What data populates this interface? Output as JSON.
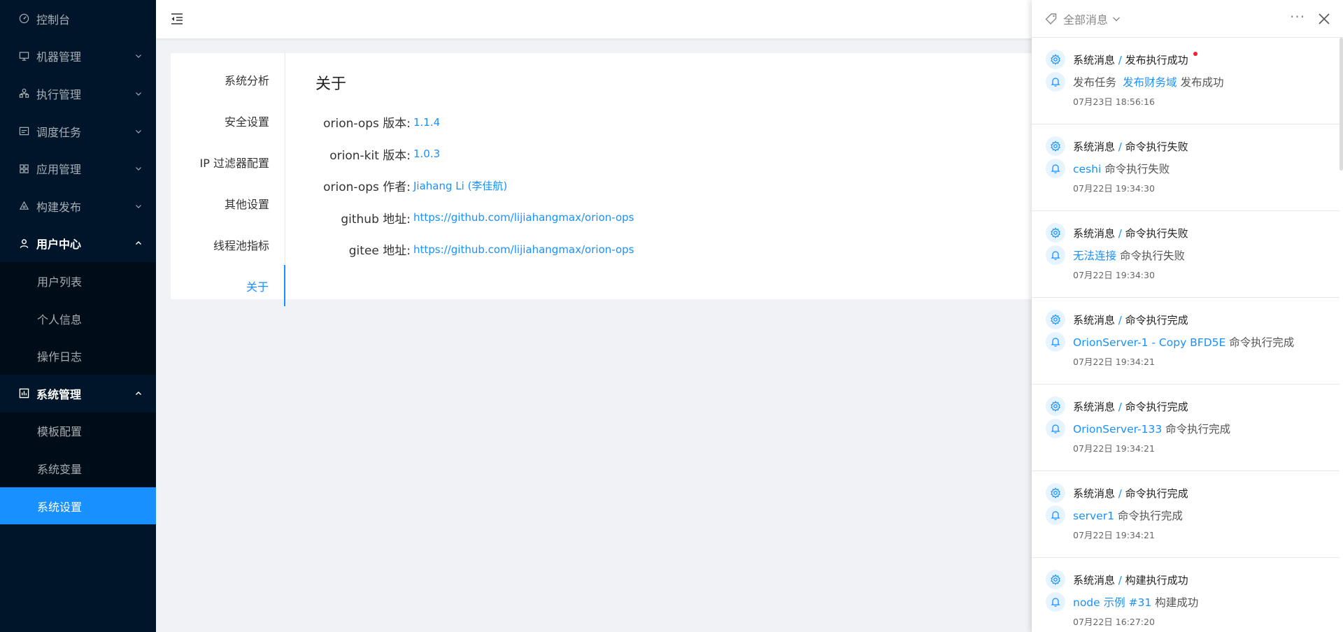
{
  "sidebar": {
    "items": [
      {
        "label": "控制台",
        "icon": "dashboard-icon"
      },
      {
        "label": "机器管理",
        "icon": "monitor-icon"
      },
      {
        "label": "执行管理",
        "icon": "cluster-icon"
      },
      {
        "label": "调度任务",
        "icon": "calendar-icon"
      },
      {
        "label": "应用管理",
        "icon": "grid-icon"
      },
      {
        "label": "构建发布",
        "icon": "build-icon"
      },
      {
        "label": "用户中心",
        "icon": "user-icon"
      },
      {
        "label": "系统管理",
        "icon": "chart-box-icon"
      }
    ],
    "user_center_sub": [
      "用户列表",
      "个人信息",
      "操作日志"
    ],
    "system_sub": [
      "模板配置",
      "系统变量",
      "系统设置"
    ]
  },
  "tabs": [
    "系统分析",
    "安全设置",
    "IP 过滤器配置",
    "其他设置",
    "线程池指标",
    "关于"
  ],
  "about": {
    "title": "关于",
    "rows": [
      {
        "k": "orion-ops 版本:",
        "v": "1.1.4"
      },
      {
        "k": "orion-kit 版本:",
        "v": "1.0.3"
      },
      {
        "k": "orion-ops 作者:",
        "v": "Jiahang Li (李佳航)"
      },
      {
        "k": "github 地址:",
        "v": "https://github.com/lijiahangmax/orion-ops"
      },
      {
        "k": "gitee 地址:",
        "v": "https://github.com/lijiahangmax/orion-ops"
      }
    ]
  },
  "notify": {
    "filter_label": "全部消息",
    "more": "···",
    "items": [
      {
        "cat": "系统消息",
        "sep": "/",
        "type": "发布执行成功",
        "pre": "发布任务",
        "link": "发布财务域",
        "post": "发布成功",
        "time": "07月23日 18:56:16"
      },
      {
        "cat": "系统消息",
        "sep": "/",
        "type": "命令执行失败",
        "pre": "",
        "link": "ceshi",
        "post": "命令执行失败",
        "time": "07月22日 19:34:30"
      },
      {
        "cat": "系统消息",
        "sep": "/",
        "type": "命令执行失败",
        "pre": "",
        "link": "无法连接",
        "post": "命令执行失败",
        "time": "07月22日 19:34:30"
      },
      {
        "cat": "系统消息",
        "sep": "/",
        "type": "命令执行完成",
        "pre": "",
        "link": "OrionServer-1 - Copy BFD5E",
        "post": "命令执行完成",
        "time": "07月22日 19:34:21"
      },
      {
        "cat": "系统消息",
        "sep": "/",
        "type": "命令执行完成",
        "pre": "",
        "link": "OrionServer-133",
        "post": "命令执行完成",
        "time": "07月22日 19:34:21"
      },
      {
        "cat": "系统消息",
        "sep": "/",
        "type": "命令执行完成",
        "pre": "",
        "link": "server1",
        "post": "命令执行完成",
        "time": "07月22日 19:34:21"
      },
      {
        "cat": "系统消息",
        "sep": "/",
        "type": "构建执行成功",
        "pre": "",
        "link": "node 示例  #31",
        "post": "构建成功",
        "time": "07月22日 16:27:20"
      }
    ]
  },
  "colors": {
    "sidebar_bg": "#001529",
    "submenu_bg": "#000c17",
    "accent": "#1890ff",
    "unread": "#f5222d"
  }
}
